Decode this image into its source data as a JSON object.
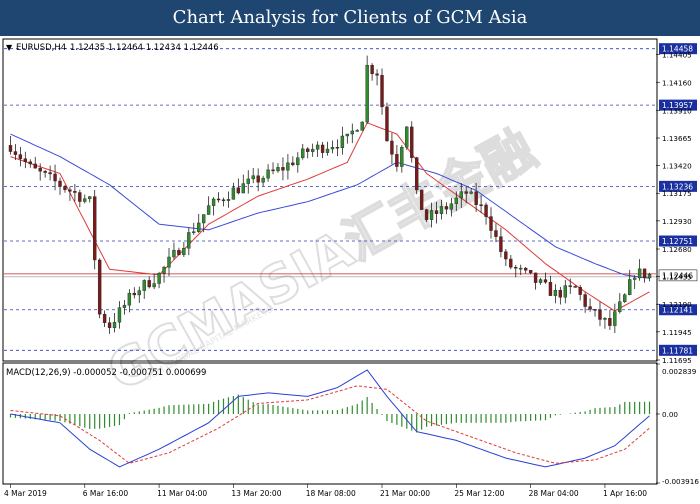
{
  "header": {
    "title": "Chart Analysis for Clients of GCM Asia"
  },
  "watermark": "GCMASIA汇丰金融",
  "watermark_sub": "GCM GLOBAL CAPITAL MARKETS",
  "colors": {
    "header_bg": "#1f4670",
    "bull": "#2e8b2e",
    "bear": "#7a1a1a",
    "ma_fast": "#e03a3a",
    "ma_slow": "#3b4bd8",
    "level_line": "#2f3fb8",
    "current_price_line": "#cc2222",
    "macd_line": "#2a3fd6",
    "signal_line": "#e03a3a",
    "histogram": "#2e8b2e"
  },
  "chart_data": [
    {
      "type": "candlestick",
      "symbol_label": "EURUSD,H4",
      "ohlc_label": "1.12435 1.12464 1.12434 1.12446",
      "x_tick_labels": [
        "4 Mar 2019",
        "6 Mar 16:00",
        "11 Mar 04:00",
        "13 Mar 20:00",
        "18 Mar 08:00",
        "21 Mar 00:00",
        "25 Mar 12:00",
        "28 Mar 04:00",
        "1 Apr 16:00"
      ],
      "x_tick_index": [
        0,
        15,
        30,
        45,
        60,
        75,
        90,
        105,
        120
      ],
      "y_tick_labels": [
        "1.14405",
        "1.14160",
        "1.13910",
        "1.13665",
        "1.13420",
        "1.13175",
        "1.12930",
        "1.12680",
        "1.12435",
        "1.12190",
        "1.11945",
        "1.11695"
      ],
      "ylim": [
        1.11695,
        1.14535
      ],
      "price_levels": [
        {
          "label": "1.14458",
          "value": 1.14458
        },
        {
          "label": "1.13957",
          "value": 1.13957
        },
        {
          "label": "1.13236",
          "value": 1.13236
        },
        {
          "label": "1.12751",
          "value": 1.12751
        },
        {
          "label": "1.12141",
          "value": 1.12141
        },
        {
          "label": "1.11781",
          "value": 1.11781
        }
      ],
      "current_price": {
        "label": "1.12446",
        "value": 1.12446
      },
      "anchors": [
        [
          0,
          1.136
        ],
        [
          4,
          1.134
        ],
        [
          10,
          1.1325
        ],
        [
          16,
          1.131
        ],
        [
          18,
          1.121
        ],
        [
          20,
          1.12
        ],
        [
          25,
          1.123
        ],
        [
          30,
          1.1245
        ],
        [
          36,
          1.128
        ],
        [
          40,
          1.1305
        ],
        [
          45,
          1.132
        ],
        [
          50,
          1.133
        ],
        [
          55,
          1.134
        ],
        [
          60,
          1.1355
        ],
        [
          64,
          1.136
        ],
        [
          68,
          1.1365
        ],
        [
          71,
          1.1385
        ],
        [
          72,
          1.143
        ],
        [
          74,
          1.1425
        ],
        [
          76,
          1.1365
        ],
        [
          78,
          1.1345
        ],
        [
          80,
          1.138
        ],
        [
          82,
          1.1315
        ],
        [
          84,
          1.1295
        ],
        [
          88,
          1.1305
        ],
        [
          92,
          1.1318
        ],
        [
          96,
          1.13
        ],
        [
          100,
          1.1255
        ],
        [
          104,
          1.1245
        ],
        [
          110,
          1.1228
        ],
        [
          114,
          1.1233
        ],
        [
          117,
          1.1213
        ],
        [
          121,
          1.12
        ],
        [
          124,
          1.1225
        ],
        [
          126,
          1.1247
        ],
        [
          129,
          1.1245
        ]
      ],
      "ma_fast_anchors": [
        [
          0,
          1.135
        ],
        [
          10,
          1.1335
        ],
        [
          20,
          1.125
        ],
        [
          30,
          1.1245
        ],
        [
          40,
          1.129
        ],
        [
          50,
          1.1315
        ],
        [
          60,
          1.133
        ],
        [
          68,
          1.1345
        ],
        [
          72,
          1.138
        ],
        [
          78,
          1.137
        ],
        [
          84,
          1.1335
        ],
        [
          92,
          1.131
        ],
        [
          100,
          1.1285
        ],
        [
          108,
          1.1255
        ],
        [
          116,
          1.123
        ],
        [
          122,
          1.1213
        ],
        [
          129,
          1.123
        ]
      ],
      "ma_slow_anchors": [
        [
          0,
          1.137
        ],
        [
          10,
          1.135
        ],
        [
          20,
          1.1325
        ],
        [
          30,
          1.129
        ],
        [
          40,
          1.1285
        ],
        [
          50,
          1.13
        ],
        [
          60,
          1.131
        ],
        [
          70,
          1.1325
        ],
        [
          78,
          1.1345
        ],
        [
          86,
          1.1335
        ],
        [
          94,
          1.132
        ],
        [
          102,
          1.1295
        ],
        [
          110,
          1.127
        ],
        [
          118,
          1.1255
        ],
        [
          124,
          1.1245
        ],
        [
          129,
          1.1242
        ]
      ],
      "candle_count": 130
    },
    {
      "type": "macd",
      "label": "MACD(12,26,9) -0.000052 -0.000751 0.000699",
      "y_tick_labels": [
        "0.002839",
        "0.00",
        "-0.003916"
      ],
      "ylim": [
        -0.003916,
        0.002839
      ],
      "macd_anchors": [
        [
          0,
          0.0
        ],
        [
          10,
          -0.0005
        ],
        [
          16,
          -0.002
        ],
        [
          22,
          -0.003
        ],
        [
          30,
          -0.002
        ],
        [
          40,
          -0.0005
        ],
        [
          46,
          0.001
        ],
        [
          52,
          0.0012
        ],
        [
          60,
          0.001
        ],
        [
          66,
          0.0015
        ],
        [
          72,
          0.0025
        ],
        [
          76,
          0.001
        ],
        [
          82,
          -0.001
        ],
        [
          90,
          -0.0015
        ],
        [
          100,
          -0.0025
        ],
        [
          108,
          -0.003
        ],
        [
          116,
          -0.0025
        ],
        [
          122,
          -0.0018
        ],
        [
          129,
          -0.0001
        ]
      ],
      "signal_anchors": [
        [
          0,
          0.0002
        ],
        [
          10,
          -0.0001
        ],
        [
          18,
          -0.0015
        ],
        [
          24,
          -0.0028
        ],
        [
          32,
          -0.0022
        ],
        [
          42,
          -0.0008
        ],
        [
          50,
          0.0006
        ],
        [
          60,
          0.0008
        ],
        [
          70,
          0.0016
        ],
        [
          76,
          0.0014
        ],
        [
          84,
          -0.0004
        ],
        [
          92,
          -0.0012
        ],
        [
          102,
          -0.0022
        ],
        [
          110,
          -0.0028
        ],
        [
          118,
          -0.0026
        ],
        [
          124,
          -0.002
        ],
        [
          129,
          -0.0008
        ]
      ]
    }
  ]
}
